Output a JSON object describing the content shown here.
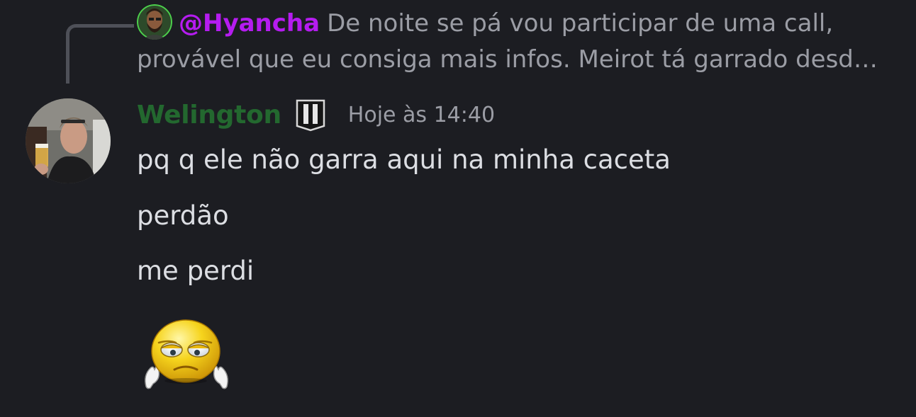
{
  "reply": {
    "author": "@Hyancha",
    "text": "De noite se pá vou participar de uma call, provável que eu consiga mais infos. Meirot tá garrado desd…"
  },
  "message": {
    "author": "Welington",
    "timestamp": "Hoje às 14:40",
    "lines": [
      "pq q ele não garra aqui na minha caceta",
      "perdão",
      "me perdi"
    ]
  },
  "colors": {
    "background": "#1c1d22",
    "reply_author": "#b51cf0",
    "author": "#23682f",
    "text": "#dcdee3",
    "muted": "#9b9da5"
  },
  "icons": {
    "reply_avatar": "user-avatar-icon",
    "avatar": "user-avatar-icon",
    "badge": "guild-tag-badge-icon",
    "emoji": "sad-face-emoji-icon"
  }
}
